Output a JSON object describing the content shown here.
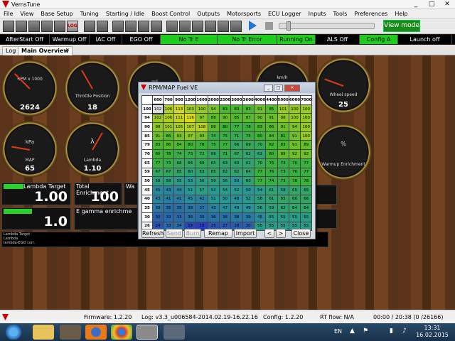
{
  "window": {
    "title": "VemsTune",
    "controls": [
      "_",
      "□",
      "✕"
    ]
  },
  "menu": [
    "File",
    "View",
    "Base Setup",
    "Tuning",
    "Starting / Idle",
    "Boost Control",
    "Outputs",
    "Motorsports",
    "ECU Logger",
    "Inputs",
    "Tools",
    "Preferences",
    "Help"
  ],
  "toolbar": {
    "view_mode": "View mode"
  },
  "indicators": [
    {
      "label": "AfterStart Off",
      "on": false
    },
    {
      "label": "Warmup Off",
      "on": false
    },
    {
      "label": "IAC Off",
      "on": false
    },
    {
      "label": "EGO Off",
      "on": false
    },
    {
      "label": "No Tr E",
      "on": true
    },
    {
      "label": "No Tr Error",
      "on": true
    },
    {
      "label": "Running On",
      "on": true
    },
    {
      "label": "ALS Off",
      "on": false
    },
    {
      "label": "Config A",
      "on": true
    },
    {
      "label": "Launch off",
      "on": false
    }
  ],
  "tabs": [
    "Log",
    "Main Overview"
  ],
  "gauges": [
    {
      "label": "RPM x 1000",
      "value": "2624"
    },
    {
      "label": "Throttle Position",
      "value": "18"
    },
    {
      "label": "mS",
      "value": ""
    },
    {
      "label": "km/h",
      "value": ""
    },
    {
      "label": "Wheel speed",
      "value": "25"
    },
    {
      "label": "kPa",
      "value": "65",
      "sub": "MAP"
    },
    {
      "label": "λ",
      "value": "1.10",
      "sub": "Lambda"
    },
    {
      "label": "%",
      "value": "",
      "sub": "Warmup Enrichment"
    }
  ],
  "displays": [
    {
      "label": "Lambda Target",
      "value": "1.00"
    },
    {
      "label": "Total Enrichment",
      "value": "100"
    },
    {
      "label": "Wa",
      "value": ""
    },
    {
      "label": "",
      "value": "1.0"
    },
    {
      "label": "E gamma enrichme",
      "value": ""
    }
  ],
  "graph_legend": [
    "Lambda Target",
    "Lambda",
    "lambda-EGO corr."
  ],
  "ve_dialog": {
    "title": "RPM/MAP Fuel VE",
    "rpm": [
      "600",
      "700",
      "900",
      "1200",
      "1600",
      "2000",
      "2500",
      "3000",
      "3600",
      "4000",
      "4400",
      "5000",
      "6000",
      "7000"
    ],
    "map": [
      "100",
      "94",
      "90",
      "85",
      "79",
      "70",
      "65",
      "59",
      "50",
      "45",
      "40",
      "35",
      "30",
      "26"
    ],
    "rows": [
      [
        "102",
        "106",
        "113",
        "103",
        "100",
        "94",
        "83",
        "83",
        "83",
        "91",
        "85",
        "101",
        "100",
        "100"
      ],
      [
        "102",
        "106",
        "111",
        "116",
        "97",
        "88",
        "90",
        "85",
        "87",
        "90",
        "91",
        "98",
        "100",
        "100"
      ],
      [
        "98",
        "101",
        "105",
        "107",
        "108",
        "88",
        "80",
        "77",
        "78",
        "83",
        "86",
        "91",
        "94",
        "100"
      ],
      [
        "91",
        "86",
        "93",
        "97",
        "93",
        "74",
        "75",
        "71",
        "75",
        "80",
        "84",
        "81",
        "91",
        "100"
      ],
      [
        "83",
        "86",
        "84",
        "80",
        "78",
        "75",
        "77",
        "66",
        "69",
        "70",
        "82",
        "83",
        "91",
        "89"
      ],
      [
        "80",
        "78",
        "74",
        "73",
        "72",
        "66",
        "71",
        "67",
        "62",
        "61",
        "80",
        "89",
        "92",
        "92"
      ],
      [
        "77",
        "73",
        "68",
        "66",
        "69",
        "65",
        "63",
        "63",
        "62",
        "70",
        "76",
        "73",
        "76",
        "77"
      ],
      [
        "67",
        "67",
        "65",
        "60",
        "63",
        "65",
        "62",
        "62",
        "64",
        "77",
        "76",
        "73",
        "76",
        "77"
      ],
      [
        "58",
        "58",
        "55",
        "53",
        "56",
        "59",
        "56",
        "50",
        "60",
        "77",
        "74",
        "73",
        "78",
        "78"
      ],
      [
        "45",
        "43",
        "44",
        "51",
        "57",
        "52",
        "54",
        "52",
        "50",
        "54",
        "61",
        "58",
        "65",
        "65"
      ],
      [
        "43",
        "41",
        "41",
        "45",
        "42",
        "51",
        "50",
        "48",
        "52",
        "58",
        "61",
        "65",
        "66",
        "66"
      ],
      [
        "39",
        "35",
        "35",
        "38",
        "37",
        "43",
        "47",
        "49",
        "49",
        "56",
        "59",
        "62",
        "64",
        "64"
      ],
      [
        "30",
        "33",
        "33",
        "36",
        "35",
        "36",
        "36",
        "38",
        "39",
        "45",
        "55",
        "55",
        "55",
        "55"
      ],
      [
        "24",
        "33",
        "34",
        "19",
        "15",
        "25",
        "27",
        "28",
        "30",
        "55",
        "55",
        "55",
        "55",
        "55"
      ]
    ],
    "buttons": {
      "refresh": "Refresh",
      "send": "Send",
      "burn": "Burn",
      "remap": "Remap",
      "import": "Import",
      "prev": "<",
      "next": ">",
      "close": "Close"
    }
  },
  "status": {
    "firmware": "Firmware: 1.2.20",
    "log": "Log: v3.3_u006584-2014.02.19-16.22.16",
    "config": "Config: 1.2.20",
    "rtflow": "RT flow: N/A",
    "time": "00:00 / 20:38 (0 /26166)"
  },
  "taskbar": {
    "lang": "EN",
    "time": "13:31",
    "date": "16.02.2015"
  }
}
